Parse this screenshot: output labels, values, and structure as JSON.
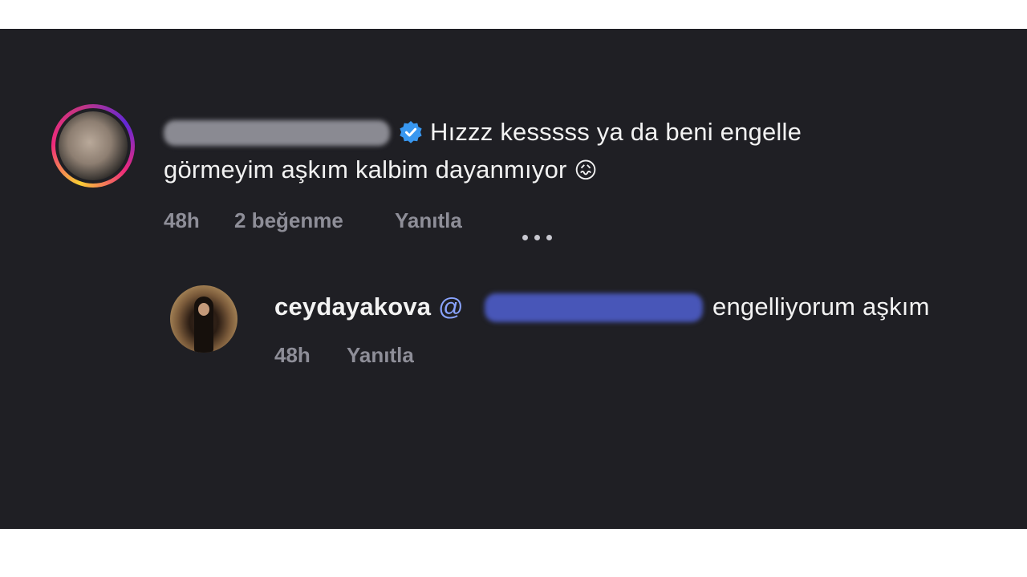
{
  "comment1": {
    "username_redacted": true,
    "verified_icon": "verified-badge-icon",
    "text_line1": "Hızzz kesssss ya da beni engelle",
    "text_line2": "görmeyim aşkım kalbim dayanmıyor",
    "emoji": "😖",
    "time": "48h",
    "likes": "2 beğenme",
    "reply_label": "Yanıtla",
    "more_icon": "more-options-icon"
  },
  "reply1": {
    "username": "ceydayakova",
    "mention_prefix": "@",
    "mention_redacted": true,
    "text": "engelliyorum aşkım",
    "time": "48h",
    "reply_label": "Yanıtla"
  },
  "colors": {
    "background": "#1f1f24",
    "text": "#f2f2f2",
    "meta": "#8e8e98",
    "mention": "#8aa4ff",
    "verified": "#3897f0"
  }
}
